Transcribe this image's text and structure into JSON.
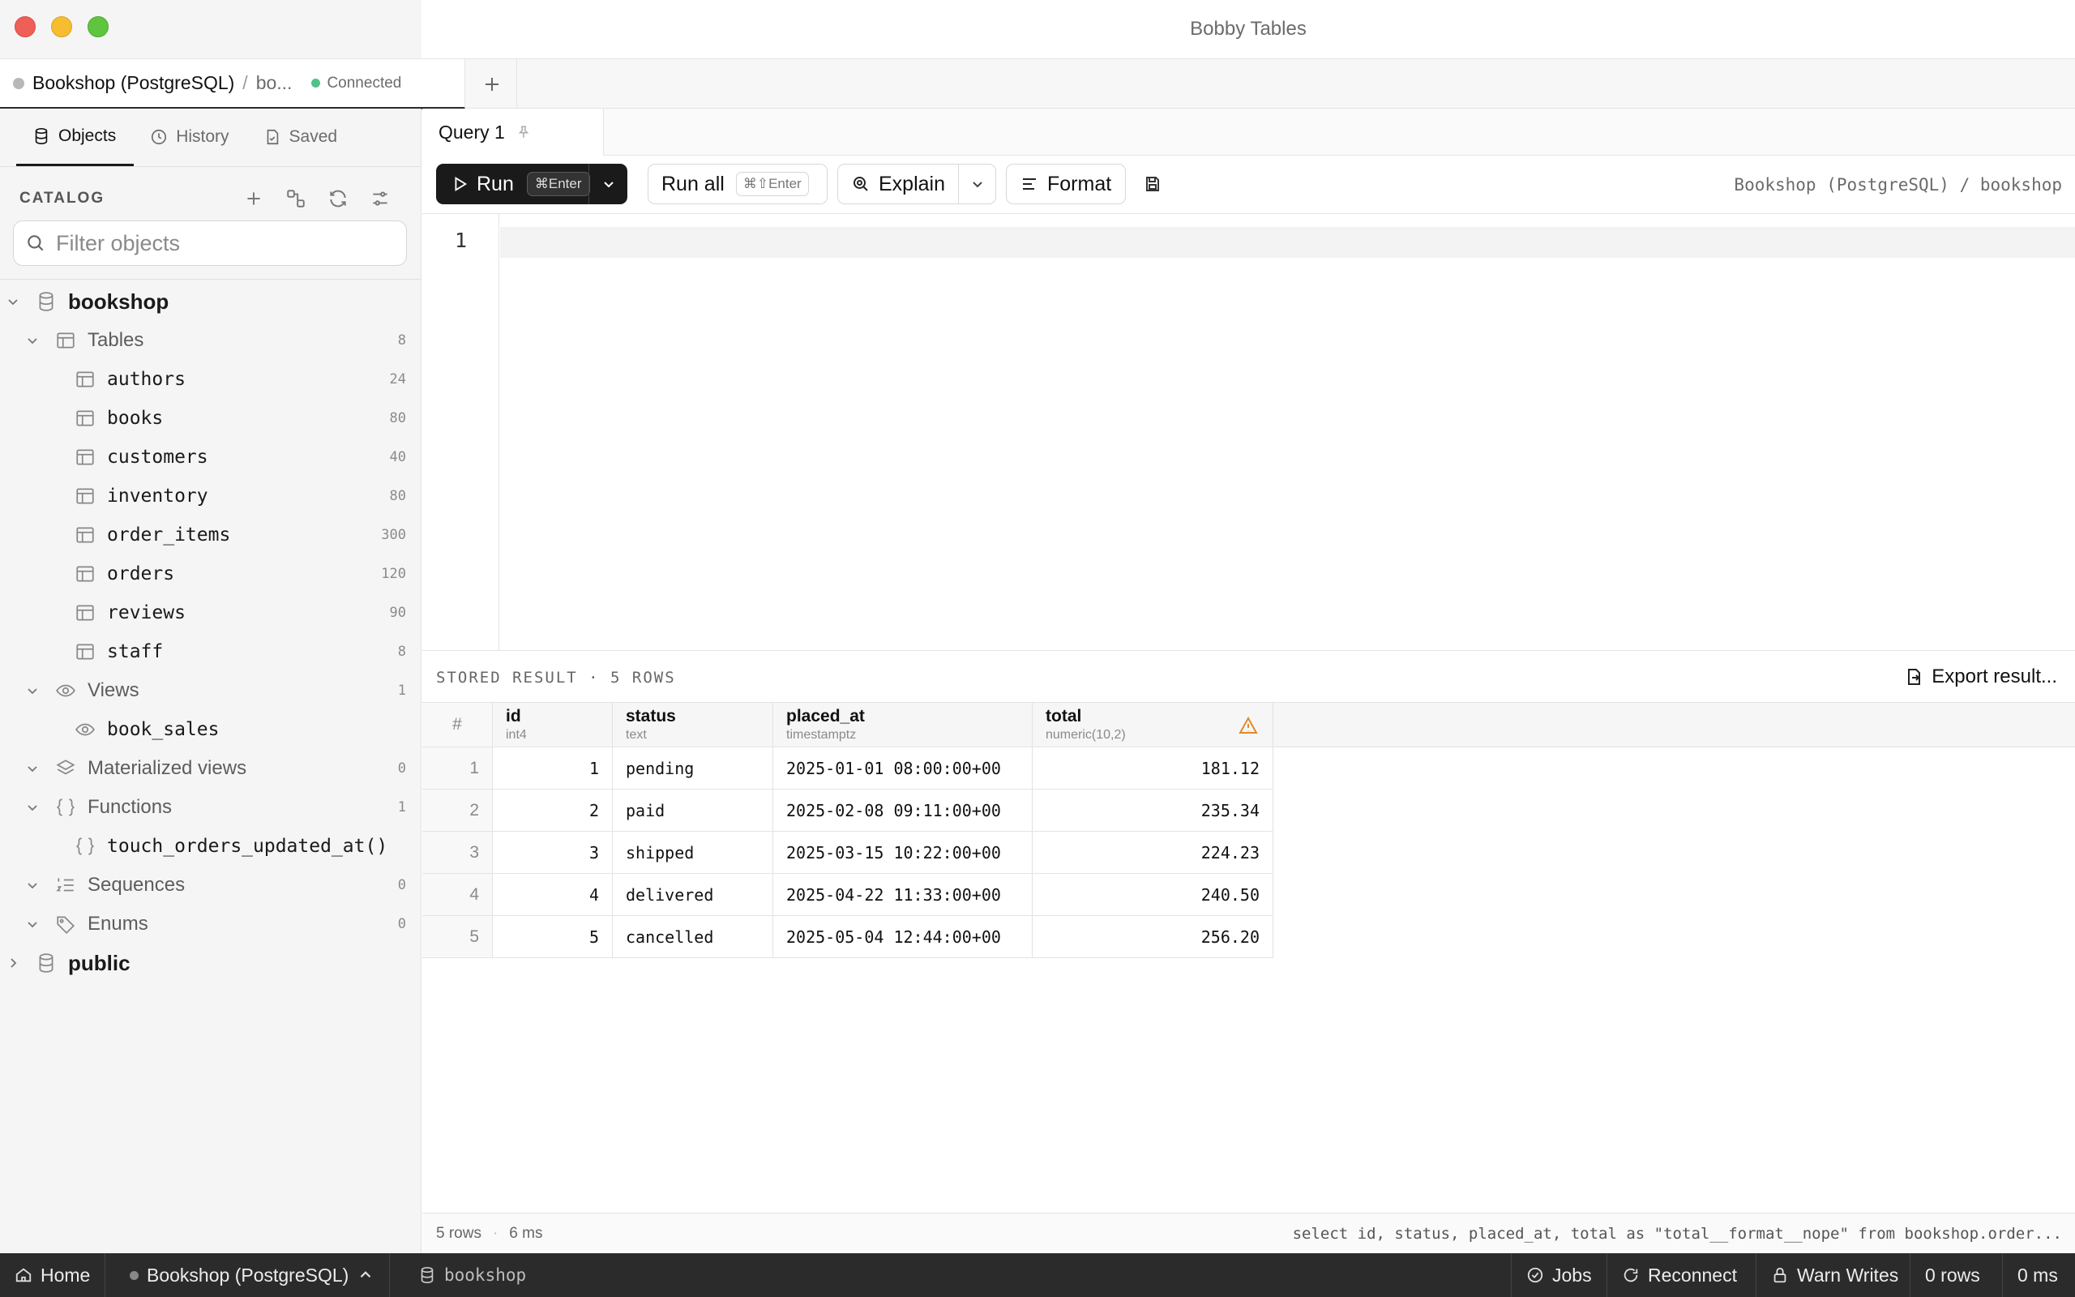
{
  "window": {
    "title": "Bobby Tables"
  },
  "connection_tab": {
    "name": "Bookshop (PostgreSQL)",
    "separator": "/",
    "database": "bo...",
    "status": "Connected"
  },
  "sidebar": {
    "tabs": [
      {
        "label": "Objects",
        "icon": "database-icon"
      },
      {
        "label": "History",
        "icon": "clock-icon"
      },
      {
        "label": "Saved",
        "icon": "bookmark-icon"
      }
    ],
    "catalog_label": "CATALOG",
    "filter_placeholder": "Filter objects",
    "tree": {
      "db": "bookshop",
      "tables_label": "Tables",
      "tables_count": "8",
      "tables": [
        {
          "name": "authors",
          "count": "24"
        },
        {
          "name": "books",
          "count": "80"
        },
        {
          "name": "customers",
          "count": "40"
        },
        {
          "name": "inventory",
          "count": "80"
        },
        {
          "name": "order_items",
          "count": "300"
        },
        {
          "name": "orders",
          "count": "120"
        },
        {
          "name": "reviews",
          "count": "90"
        },
        {
          "name": "staff",
          "count": "8"
        }
      ],
      "views_label": "Views",
      "views_count": "1",
      "views": [
        {
          "name": "book_sales"
        }
      ],
      "matviews_label": "Materialized views",
      "matviews_count": "0",
      "functions_label": "Functions",
      "functions_count": "1",
      "functions": [
        {
          "name": "touch_orders_updated_at()"
        }
      ],
      "sequences_label": "Sequences",
      "sequences_count": "0",
      "enums_label": "Enums",
      "enums_count": "0",
      "schema2": "public"
    }
  },
  "query_tab": {
    "label": "Query 1"
  },
  "toolbar": {
    "run_label": "Run",
    "run_kbd": "⌘Enter",
    "runall_label": "Run all",
    "runall_kbd": "⌘⇧Enter",
    "explain_label": "Explain",
    "format_label": "Format",
    "path": "Bookshop (PostgreSQL) / bookshop"
  },
  "editor": {
    "line_number": "1"
  },
  "result": {
    "label": "STORED RESULT · 5 ROWS",
    "export_label": "Export result...",
    "columns": [
      {
        "name": "#",
        "type": ""
      },
      {
        "name": "id",
        "type": "int4"
      },
      {
        "name": "status",
        "type": "text"
      },
      {
        "name": "placed_at",
        "type": "timestamptz"
      },
      {
        "name": "total",
        "type": "numeric(10,2)"
      }
    ],
    "rows": [
      {
        "idx": "1",
        "id": "1",
        "status": "pending",
        "placed_at": "2025-01-01 08:00:00+00",
        "total": "181.12"
      },
      {
        "idx": "2",
        "id": "2",
        "status": "paid",
        "placed_at": "2025-02-08 09:11:00+00",
        "total": "235.34"
      },
      {
        "idx": "3",
        "id": "3",
        "status": "shipped",
        "placed_at": "2025-03-15 10:22:00+00",
        "total": "224.23"
      },
      {
        "idx": "4",
        "id": "4",
        "status": "delivered",
        "placed_at": "2025-04-22 11:33:00+00",
        "total": "240.50"
      },
      {
        "idx": "5",
        "id": "5",
        "status": "cancelled",
        "placed_at": "2025-05-04 12:44:00+00",
        "total": "256.20"
      }
    ],
    "status_rows": "5 rows",
    "status_time": "6 ms",
    "sql_preview": "select id, status, placed_at, total as \"total__format__nope\" from bookshop.order..."
  },
  "bottombar": {
    "home": "Home",
    "connection": "Bookshop (PostgreSQL)",
    "database": "bookshop",
    "jobs": "Jobs",
    "reconnect": "Reconnect",
    "warn_writes": "Warn Writes",
    "rows": "0 rows",
    "time": "0 ms"
  },
  "colors": {
    "accent": "#1a1a1a",
    "connected": "#4fc28a",
    "warning": "#e08a2b"
  }
}
